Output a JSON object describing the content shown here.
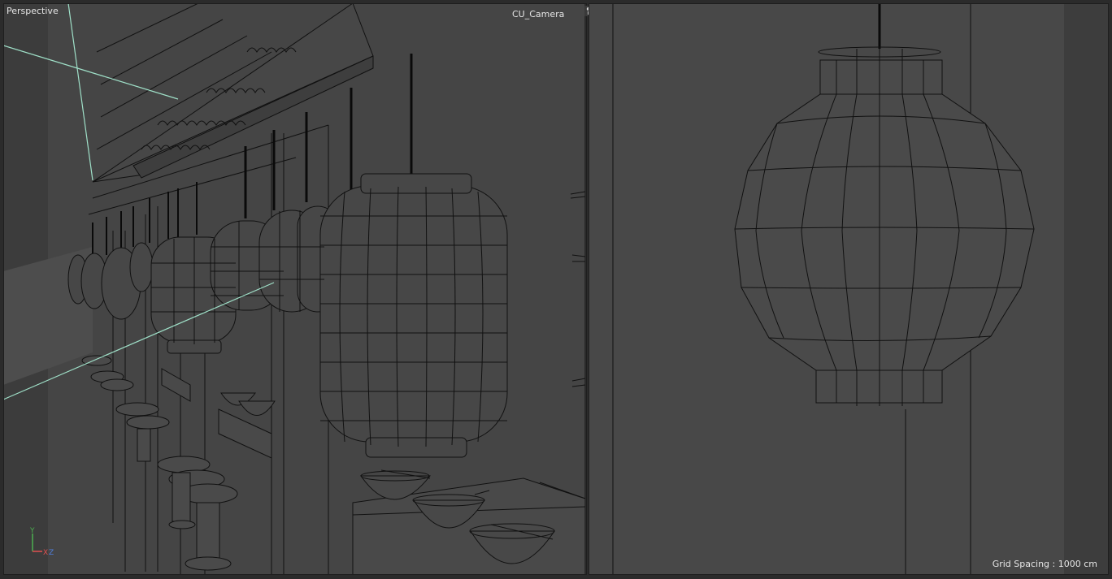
{
  "viewports": {
    "left": {
      "label": "Perspective"
    },
    "right": {
      "camera_label": "CU_Camera",
      "grid_spacing": "Grid Spacing : 1000 cm"
    }
  },
  "axis": {
    "y": "Y",
    "x": "X",
    "z": "Z"
  },
  "icons": {
    "camera": "camera-icon"
  },
  "colors": {
    "viewport_bg": "#454545",
    "wire": "#111111",
    "camera_frustum": "#9fe0c8",
    "axis_y": "#4caf50",
    "axis_x": "#e05050",
    "axis_z": "#5080e0",
    "label_text": "#e6e6e6"
  }
}
